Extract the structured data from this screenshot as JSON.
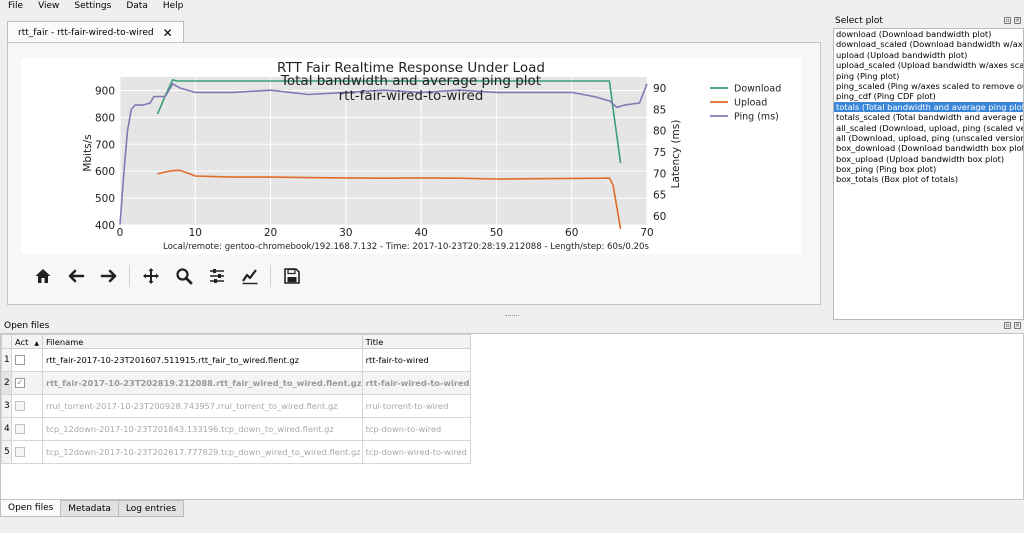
{
  "menubar": {
    "items": [
      "File",
      "View",
      "Settings",
      "Data",
      "Help"
    ]
  },
  "tab": {
    "label": "rtt_fair - rtt-fair-wired-to-wired",
    "close": "✕"
  },
  "chart_data": {
    "type": "line",
    "title": [
      "RTT Fair Realtime Response Under Load",
      "Total bandwidth and average ping plot",
      "rtt-fair-wired-to-wired"
    ],
    "xlabel": "",
    "ylabel": "Mbits/s",
    "y2label": "Latency (ms)",
    "xlim": [
      0,
      70
    ],
    "ylim": [
      400,
      950
    ],
    "y2lim": [
      57.9,
      92.6
    ],
    "xticks": [
      "0",
      "10",
      "20",
      "30",
      "40",
      "50",
      "60",
      "70"
    ],
    "yticks": [
      "400",
      "500",
      "600",
      "700",
      "800",
      "900"
    ],
    "y2ticks": [
      "60",
      "65",
      "70",
      "75",
      "80",
      "85",
      "90"
    ],
    "grid": true,
    "legend_position": "right",
    "footnote": "Local/remote: gentoo-chromebook/192.168.7.132 - Time: 2017-10-23T20:28:19.212088 - Length/step: 60s/0.20s",
    "series": [
      {
        "name": "Download",
        "axis": "left",
        "color": "#3a9e77",
        "x": [
          5,
          6,
          7,
          7.5,
          10,
          15,
          20,
          30,
          40,
          50,
          60,
          64,
          65,
          65.6,
          66.5
        ],
        "y": [
          813,
          880,
          940,
          935,
          935,
          935,
          935,
          935,
          935,
          935,
          935,
          935,
          935,
          810,
          630
        ]
      },
      {
        "name": "Upload",
        "axis": "left",
        "color": "#e06b26",
        "x": [
          5,
          6,
          7,
          8,
          9,
          10,
          15,
          20,
          25,
          30,
          35,
          40,
          45,
          50,
          55,
          60,
          64,
          65,
          65.5,
          66.5
        ],
        "y": [
          590,
          597,
          602,
          603,
          593,
          582,
          578,
          578,
          576,
          575,
          574,
          575,
          574,
          571,
          572,
          573,
          574,
          575,
          548,
          385
        ]
      },
      {
        "name": "Ping (ms)",
        "axis": "right",
        "color": "#8079b6",
        "x": [
          0,
          0.5,
          1,
          1.5,
          2,
          3,
          4,
          4.5,
          5,
          6,
          7,
          8,
          10,
          15,
          20,
          25,
          30,
          35,
          40,
          45,
          50,
          55,
          60,
          63,
          65,
          66,
          67,
          69,
          70
        ],
        "y": [
          58,
          70,
          80,
          85,
          86,
          86,
          86.5,
          88,
          88,
          88,
          91,
          90,
          89,
          89,
          89.5,
          88.5,
          89,
          89.5,
          89,
          89.5,
          89,
          89,
          89,
          88,
          87,
          85.5,
          86,
          86.5,
          91
        ]
      }
    ]
  },
  "toolbar": {
    "buttons": [
      {
        "name": "home-icon"
      },
      {
        "name": "back-arrow-icon"
      },
      {
        "name": "forward-arrow-icon"
      },
      {
        "name": "pan-icon"
      },
      {
        "name": "zoom-icon"
      },
      {
        "name": "sliders-icon"
      },
      {
        "name": "edit-axes-icon"
      },
      {
        "name": "save-icon"
      }
    ]
  },
  "select_plot": {
    "title": "Select plot",
    "items": [
      "download (Download bandwidth plot)",
      "download_scaled (Download bandwidth w/axes scaled to remove outliers)",
      "upload (Upload bandwidth plot)",
      "upload_scaled (Upload bandwidth w/axes scaled to remove outliers)",
      "ping (Ping plot)",
      "ping_scaled (Ping w/axes scaled to remove outliers)",
      "ping_cdf (Ping CDF plot)",
      "totals (Total bandwidth and average ping plot)",
      "totals_scaled (Total bandwidth and average ping plot (scaled))",
      "all_scaled (Download, upload, ping (scaled versions))",
      "all (Download, upload, ping (unscaled versions))",
      "box_download (Download bandwidth box plot)",
      "box_upload (Upload bandwidth box plot)",
      "box_ping (Ping box plot)",
      "box_totals (Box plot of totals)"
    ],
    "selected_index": 7
  },
  "open_files": {
    "title": "Open files",
    "columns": {
      "rownum": "",
      "act": "Act",
      "filename": "Filename",
      "title": "Title"
    },
    "rows": [
      {
        "num": "1",
        "checked": false,
        "active": false,
        "enabled": true,
        "filename": "rtt_fair-2017-10-23T201607.511915.rtt_fair_to_wired.flent.gz",
        "title": "rtt-fair-to-wired"
      },
      {
        "num": "2",
        "checked": true,
        "active": true,
        "enabled": true,
        "filename": "rtt_fair-2017-10-23T202819.212088.rtt_fair_wired_to_wired.flent.gz",
        "title": "rtt-fair-wired-to-wired"
      },
      {
        "num": "3",
        "checked": false,
        "active": false,
        "enabled": false,
        "filename": "rrul_torrent-2017-10-23T200928.743957.rrul_torrent_to_wired.flent.gz",
        "title": "rrul-torrent-to-wired"
      },
      {
        "num": "4",
        "checked": false,
        "active": false,
        "enabled": false,
        "filename": "tcp_12down-2017-10-23T201843.133196.tcp_down_to_wired.flent.gz",
        "title": "tcp-down-to-wired"
      },
      {
        "num": "5",
        "checked": false,
        "active": false,
        "enabled": false,
        "filename": "tcp_12down-2017-10-23T202617.777829.tcp_down_wired_to_wired.flent.gz",
        "title": "tcp-down-wired-to-wired"
      }
    ]
  },
  "bottom_tabs": {
    "items": [
      "Open files",
      "Metadata",
      "Log entries"
    ],
    "active_index": 0
  }
}
